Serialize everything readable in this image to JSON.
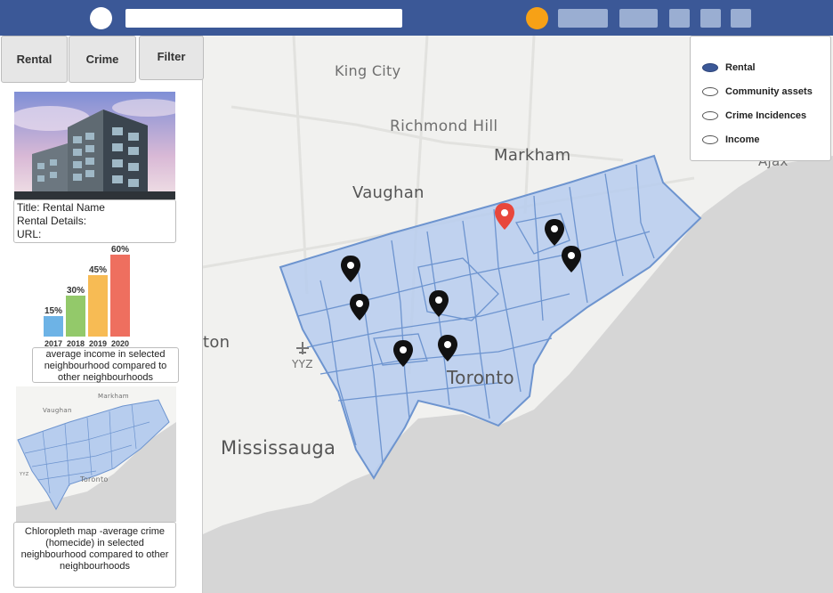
{
  "map": {
    "labels": {
      "king_city": "King City",
      "richmond_hill": "Richmond Hill",
      "markham": "Markham",
      "vaughan": "Vaughan",
      "toronto": "Toronto",
      "mississauga": "Mississauga",
      "brampton_fragment": "ton",
      "ajax_fragment": "Ajax",
      "airport": "YYZ"
    },
    "colors": {
      "land": "#f1f1ef",
      "water": "#d6d6d6",
      "region_fill": "#b7cdee",
      "region_stroke": "#6d94cf",
      "marker": "#111111",
      "marker_selected": "#e8473c"
    }
  },
  "tabs": [
    {
      "label": "Rental"
    },
    {
      "label": "Crime"
    },
    {
      "label": "Filter"
    }
  ],
  "rental_info": {
    "title": "Title: Rental Name",
    "details": "Rental Details:",
    "url": "URL:"
  },
  "income_chart": {
    "caption": "average income in selected neighbourhood compared to other neighbourhoods"
  },
  "chart_data": {
    "type": "bar",
    "categories": [
      "2017",
      "2018",
      "2019",
      "2020"
    ],
    "values": [
      15,
      30,
      45,
      60
    ],
    "value_labels": [
      "15%",
      "30%",
      "45%",
      "60%"
    ],
    "colors": [
      "#6db3e6",
      "#93c96a",
      "#f7bb54",
      "#ee6f5f"
    ],
    "title": "",
    "xlabel": "",
    "ylabel": "",
    "ylim": [
      0,
      60
    ]
  },
  "crime_map": {
    "caption": "Chloropleth map -average crime (homecide) in selected neighbourhood compared to other neighbourhoods",
    "labels": {
      "vaughan": "Vaughan",
      "markham": "Markham",
      "toronto": "Toronto",
      "airport": "YYZ"
    }
  },
  "legend": {
    "items": [
      {
        "label": "Rental",
        "selected": true
      },
      {
        "label": "Community assets",
        "selected": false
      },
      {
        "label": "Crime Incidences",
        "selected": false
      },
      {
        "label": "Income",
        "selected": false
      }
    ]
  },
  "header": {
    "accent": "#3b5897",
    "avatar_color": "#f7a116"
  }
}
